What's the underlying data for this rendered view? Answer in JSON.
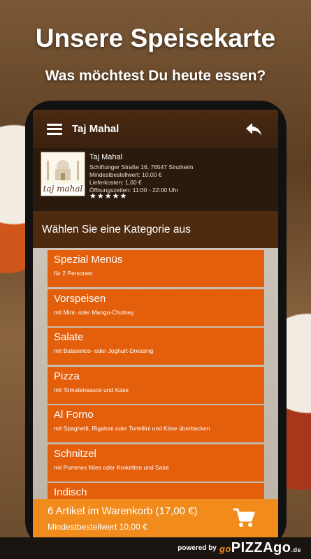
{
  "promo": {
    "headline": "Unsere Speisekarte",
    "subline": "Was möchtest Du heute essen?"
  },
  "appbar": {
    "title": "Taj Mahal",
    "menu_icon": "hamburger-menu-icon",
    "back_icon": "reply-arrow-icon"
  },
  "restaurant": {
    "logo_text": "taj mahal",
    "name": "Taj Mahal",
    "address": "Schiftunger Straße 16, 76547 Sinzheim",
    "min_order": "Mindestbestellwert: 10,00 €",
    "delivery_cost": "Lieferkosten: 1,00 €",
    "hours": "Öffnungszeiten: 11:00 - 22:00 Uhr",
    "stars": "★★★★★",
    "rating": 5
  },
  "categories_header": "Wählen Sie eine Kategorie aus",
  "categories": [
    {
      "title": "Spezial Menüs",
      "subtitle": "für 2 Personen"
    },
    {
      "title": "Vorspeisen",
      "subtitle": "mit Mint- oder Mango-Chutney"
    },
    {
      "title": "Salate",
      "subtitle": "mit Balsamico- oder Joghurt-Dressing"
    },
    {
      "title": "Pizza",
      "subtitle": "mit Tomatensauce und Käse"
    },
    {
      "title": "Al Forno",
      "subtitle": "mit Spaghetti, Rigatoni oder Tortellini und Käse überbacken"
    },
    {
      "title": "Schnitzel",
      "subtitle": "mit Pommes frites oder Kroketten und Salat"
    },
    {
      "title": "Indisch",
      "subtitle": ""
    }
  ],
  "cart": {
    "summary": "6 Artikel im Warenkorb (17,00 €)",
    "min_order": "Mindestbestellwert 10,00 €",
    "icon": "shopping-cart-icon"
  },
  "footer": {
    "powered_by": "powered by",
    "brand_go": "go",
    "brand_main": "PIZZAgo",
    "brand_tld": ".de"
  },
  "colors": {
    "category_bg": "#e35f0c",
    "cart_bg": "#f08b1c",
    "appbar_bg": "#3a200e"
  }
}
